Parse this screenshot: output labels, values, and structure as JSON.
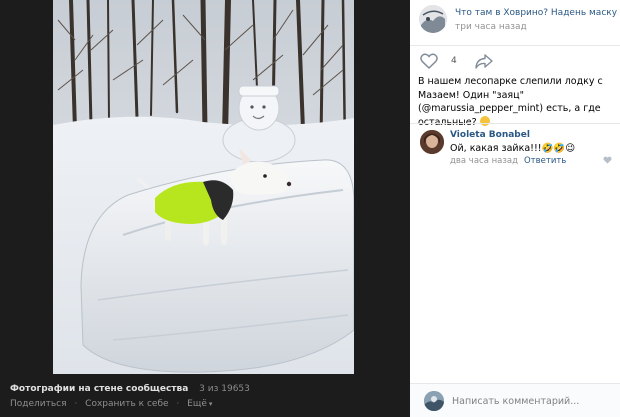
{
  "viewer": {
    "album_title": "Фотографии на стене сообщества",
    "counter": "3 из 19653",
    "share_label": "Поделиться",
    "save_label": "Сохранить к себе",
    "more_label": "Ещё"
  },
  "post": {
    "group_name": "Что там в Ховрино? Надень маску",
    "time": "три часа назад",
    "likes_count": "4",
    "text": "В нашем лесопарке слепили лодку с Мазаем! Один \"заяц\" (@marussia_pepper_mint) есть, а где остальные?"
  },
  "comment": {
    "author": "Violeta Bonabel",
    "text": "Ой, какая зайка!!!🤣🤣😉",
    "time": "два часа назад",
    "reply_label": "Ответить"
  },
  "compose": {
    "placeholder": "Написать комментарий..."
  },
  "colors": {
    "viewer_bg": "#1c1c1c",
    "link": "#2a5885",
    "muted": "#939393"
  }
}
